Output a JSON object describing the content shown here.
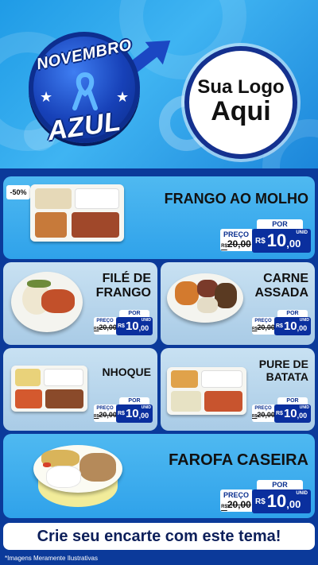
{
  "header": {
    "badge_top": "NOVEMBRO",
    "badge_bottom": "AZUL",
    "logo_line1": "Sua Logo",
    "logo_line2": "Aqui"
  },
  "discount_label": "-50%",
  "products": [
    {
      "name": "FRANGO AO MOLHO",
      "por": "POR",
      "old_label": "PREÇO",
      "old_currency": "R$",
      "old_price": "20,00",
      "currency": "R$",
      "price_int": "10",
      "price_dec": ",00",
      "unit": "UNID"
    },
    {
      "name_l1": "FILÉ DE",
      "name_l2": "FRANGO",
      "por": "POR",
      "old_label": "PREÇO",
      "old_currency": "R$",
      "old_price": "20,00",
      "currency": "R$",
      "price_int": "10",
      "price_dec": ",00",
      "unit": "UNID"
    },
    {
      "name_l1": "CARNE",
      "name_l2": "ASSADA",
      "por": "POR",
      "old_label": "PREÇO",
      "old_currency": "R$",
      "old_price": "20,00",
      "currency": "R$",
      "price_int": "10",
      "price_dec": ",00",
      "unit": "UNID"
    },
    {
      "name": "NHOQUE",
      "por": "POR",
      "old_label": "PREÇO",
      "old_currency": "R$",
      "old_price": "20,00",
      "currency": "R$",
      "price_int": "10",
      "price_dec": ",00",
      "unit": "UNID"
    },
    {
      "name_l1": "PURE DE",
      "name_l2": "BATATA",
      "por": "POR",
      "old_label": "PREÇO",
      "old_currency": "R$",
      "old_price": "20,00",
      "currency": "R$",
      "price_int": "10",
      "price_dec": ",00",
      "unit": "UNID"
    },
    {
      "name": "FAROFA CASEIRA",
      "por": "POR",
      "old_label": "PREÇO",
      "old_currency": "R$",
      "old_price": "20,00",
      "currency": "R$",
      "price_int": "10",
      "price_dec": ",00",
      "unit": "UNID"
    }
  ],
  "cta": "Crie seu encarte com este tema!",
  "disclaimer": "*Imagens Meramente Ilustrativas",
  "colors": {
    "accent_blue": "#0a2f9e",
    "panel_blue": "#3fadee",
    "panel_light": "#b8d6ec",
    "background": "#0b3a9a"
  }
}
